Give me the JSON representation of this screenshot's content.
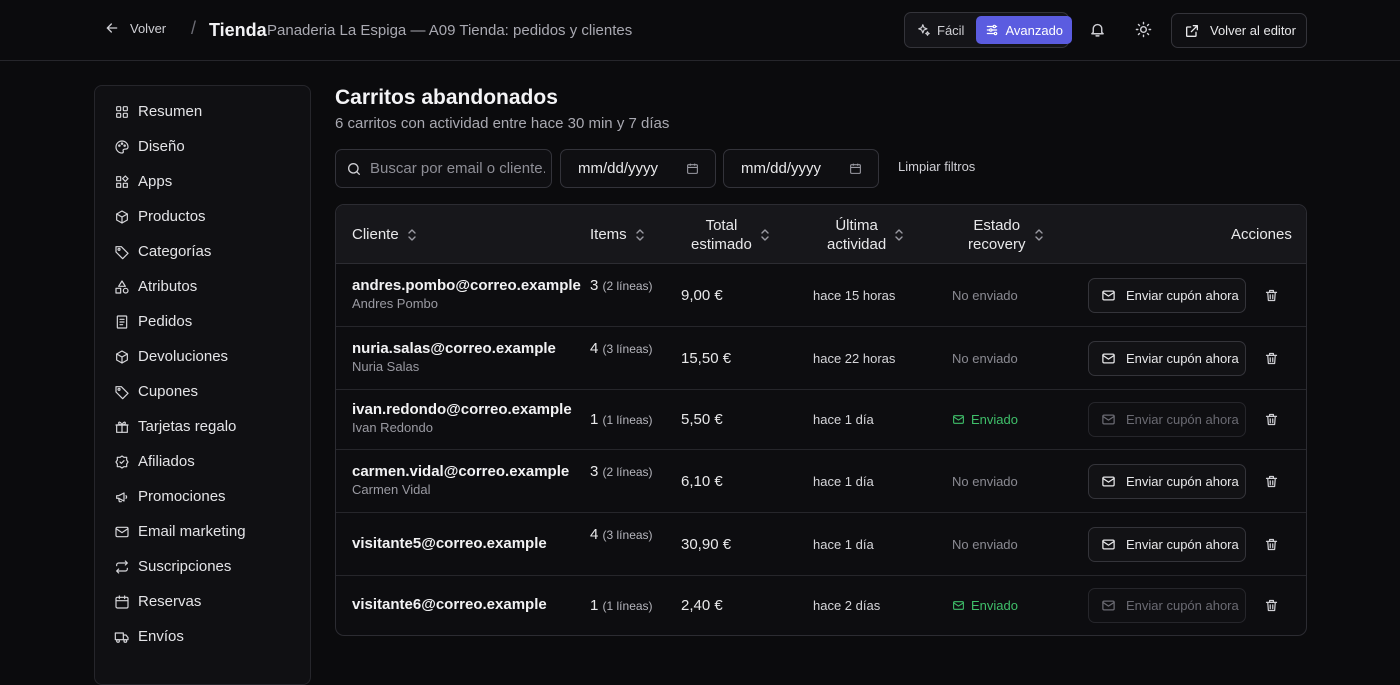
{
  "topbar": {
    "back_label": "Volver",
    "separator": "/",
    "brand": "Tienda",
    "subtitle": "Panaderia La Espiga — A09 Tienda: pedidos y clientes",
    "mode_easy": "Fácil",
    "mode_advanced": "Avanzado",
    "active_mode": "Avanzado",
    "editor_label": "Volver al editor"
  },
  "sidebar": {
    "items": [
      {
        "label": "Resumen",
        "icon": "grid-icon"
      },
      {
        "label": "Diseño",
        "icon": "palette-icon"
      },
      {
        "label": "Apps",
        "icon": "apps-icon"
      },
      {
        "label": "Productos",
        "icon": "box-icon"
      },
      {
        "label": "Categorías",
        "icon": "tag-icon"
      },
      {
        "label": "Atributos",
        "icon": "shapes-icon"
      },
      {
        "label": "Pedidos",
        "icon": "receipt-icon"
      },
      {
        "label": "Devoluciones",
        "icon": "box-icon"
      },
      {
        "label": "Cupones",
        "icon": "tag-icon"
      },
      {
        "label": "Tarjetas regalo",
        "icon": "gift-icon"
      },
      {
        "label": "Afiliados",
        "icon": "badge-icon"
      },
      {
        "label": "Promociones",
        "icon": "megaphone-icon"
      },
      {
        "label": "Email marketing",
        "icon": "mail-icon"
      },
      {
        "label": "Suscripciones",
        "icon": "repeat-icon"
      },
      {
        "label": "Reservas",
        "icon": "calendar-icon"
      },
      {
        "label": "Envíos",
        "icon": "truck-icon"
      }
    ]
  },
  "main": {
    "title": "Carritos abandonados",
    "subtitle": "6 carritos con actividad entre hace 30 min y 7 días",
    "search_placeholder": "Buscar por email o cliente...",
    "date_from": "mm/dd/yyyy",
    "date_to": "mm/dd/yyyy",
    "clear_filters": "Limpiar filtros"
  },
  "table": {
    "headers": {
      "client": "Cliente",
      "items": "Items",
      "total_1": "Total",
      "total_2": "estimado",
      "activity_1": "Última",
      "activity_2": "actividad",
      "status_1": "Estado",
      "status_2": "recovery",
      "actions": "Acciones"
    },
    "coupon_label": "Enviar cupón ahora",
    "rows": [
      {
        "email": "andres.pombo@correo.example",
        "name": "Andres Pombo",
        "items": "3",
        "lines": "(2 líneas)",
        "total": "9,00 €",
        "activity": "hace 15 horas",
        "status": "No enviado",
        "sent": false
      },
      {
        "email": "nuria.salas@correo.example",
        "name": "Nuria Salas",
        "items": "4",
        "lines": "(3 líneas)",
        "total": "15,50 €",
        "activity": "hace 22 horas",
        "status": "No enviado",
        "sent": false
      },
      {
        "email": "ivan.redondo@correo.example",
        "name": "Ivan Redondo",
        "items": "1",
        "lines": "(1 líneas)",
        "total": "5,50 €",
        "activity": "hace 1 día",
        "status": "Enviado",
        "sent": true
      },
      {
        "email": "carmen.vidal@correo.example",
        "name": "Carmen Vidal",
        "items": "3",
        "lines": "(2 líneas)",
        "total": "6,10 €",
        "activity": "hace 1 día",
        "status": "No enviado",
        "sent": false
      },
      {
        "email": "visitante5@correo.example",
        "name": "",
        "items": "4",
        "lines": "(3 líneas)",
        "total": "30,90 €",
        "activity": "hace 1 día",
        "status": "No enviado",
        "sent": false
      },
      {
        "email": "visitante6@correo.example",
        "name": "",
        "items": "1",
        "lines": "(1 líneas)",
        "total": "2,40 €",
        "activity": "hace 2 días",
        "status": "Enviado",
        "sent": true
      }
    ]
  },
  "colors": {
    "accent": "#5b5ce0",
    "sent": "#3fbf6a",
    "background": "#0b0b0d"
  }
}
